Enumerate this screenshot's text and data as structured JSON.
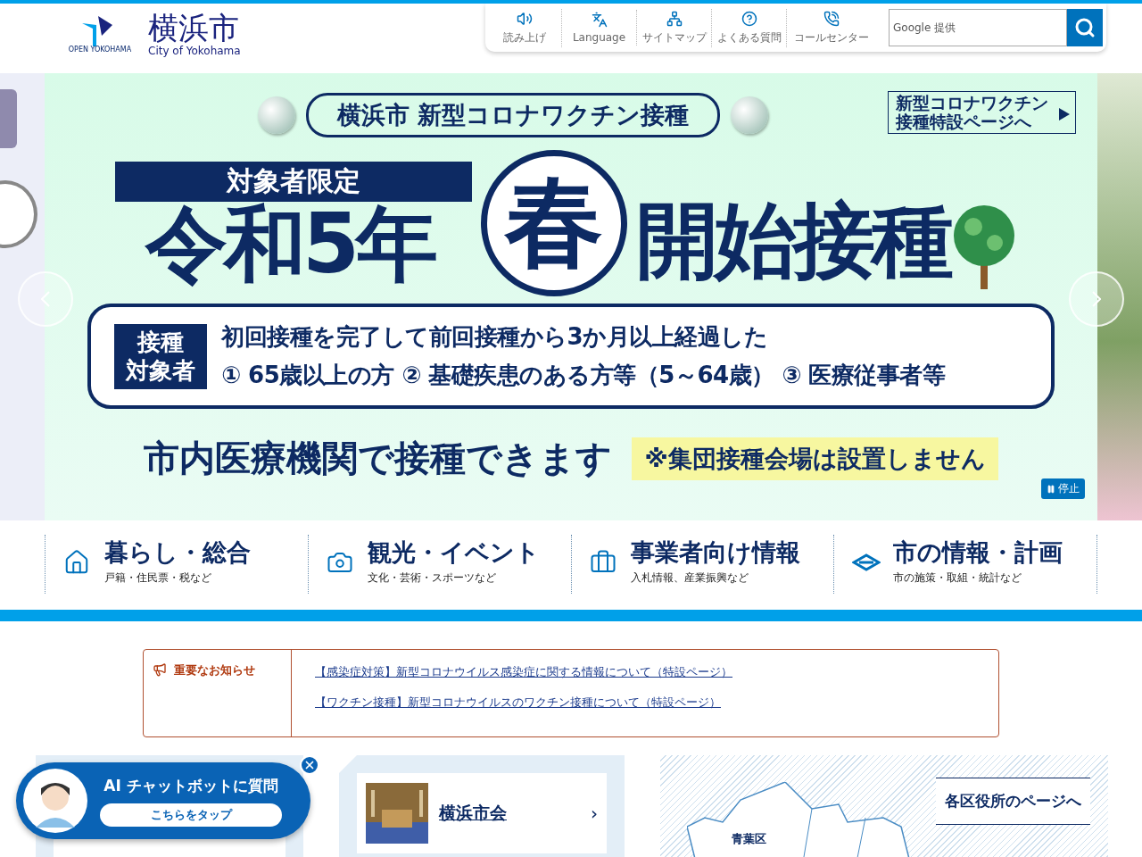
{
  "header": {
    "logo_mark": "OPEN YOKOHAMA",
    "site_name": "横浜市",
    "site_name_en": "City of Yokohama",
    "tools": [
      {
        "label": "読み上げ",
        "kind": "speaker"
      },
      {
        "label": "Language",
        "kind": "language"
      },
      {
        "label": "サイトマップ",
        "kind": "sitemap"
      },
      {
        "label": "よくある質問",
        "kind": "question"
      },
      {
        "label": "コールセンター",
        "kind": "phone"
      }
    ],
    "search": {
      "placeholder": "Google 提供"
    }
  },
  "banner": {
    "title": "横浜市 新型コロナワクチン接種",
    "side_link": [
      "新型コロナワクチン",
      "接種特設ページへ"
    ],
    "ribbon": "対象者限定",
    "headline_pre": "令和5年",
    "headline_circle": "春",
    "headline_post": "開始接種",
    "target_label": [
      "接種",
      "対象者"
    ],
    "target_lines": [
      "初回接種を完了して前回接種から3か月以上経過した",
      "① 65歳以上の方 ② 基礎疾患のある方等（5～64歳） ③ 医療従事者等"
    ],
    "footer": "市内医療機関で接種できます",
    "note": "※集団接種会場は設置しません",
    "pause": "停止"
  },
  "categories": [
    {
      "title": "暮らし・総合",
      "sub": "戸籍・住民票・税など",
      "kind": "house"
    },
    {
      "title": "観光・イベント",
      "sub": "文化・芸術・スポーツなど",
      "kind": "camera"
    },
    {
      "title": "事業者向け情報",
      "sub": "入札情報、産業振興など",
      "kind": "toolbox"
    },
    {
      "title": "市の情報・計画",
      "sub": "市の施策・取組・統計など",
      "kind": "emblem"
    }
  ],
  "notice": {
    "label": "重要なお知らせ",
    "links": [
      "【感染症対策】新型コロナウイルス感染症に関する情報について（特設ページ）",
      "【ワクチン接種】新型コロナウイルスのワクチン接種について（特設ページ）"
    ]
  },
  "chatbot": {
    "title": "AI チャットボットに質問",
    "button": "こちらをタップ"
  },
  "council": {
    "label": "横浜市会",
    "arrow": "›"
  },
  "wards": {
    "link": "各区役所のページへ",
    "map_label": "青葉区"
  }
}
